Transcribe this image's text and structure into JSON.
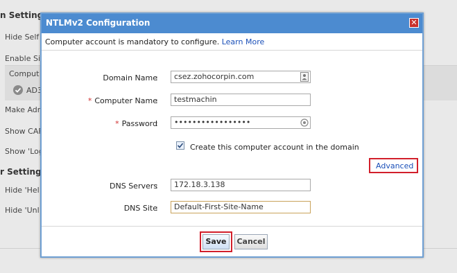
{
  "background": {
    "section1_title": "n Settings",
    "rows1": [
      "Hide Self",
      "Enable Si"
    ],
    "panel_item1": "Comput",
    "panel_item2": "AD3",
    "rows2": [
      "Make Adr",
      "Show CAF",
      "Show 'Log"
    ],
    "section2_title": "r Settings",
    "rows3": [
      "Hide 'Hel",
      "Hide 'Unl"
    ]
  },
  "dialog": {
    "title": "NTLMv2 Configuration",
    "close_symbol": "✕",
    "info_text": "Computer account is mandatory to configure.",
    "learn_more": "Learn More",
    "fields": {
      "domain_name": {
        "label": "Domain Name",
        "value": "csez.zohocorpin.com"
      },
      "computer_name": {
        "label": "Computer Name",
        "required_mark": "*",
        "value": "testmachin"
      },
      "password": {
        "label": "Password",
        "required_mark": "*",
        "value": "•••••••••••••••••"
      },
      "dns_servers": {
        "label": "DNS Servers",
        "value": "172.18.3.138"
      },
      "dns_site": {
        "label": "DNS Site",
        "value": "Default-First-Site-Name"
      }
    },
    "colon": ":",
    "create_account_label": "Create this computer account in the domain",
    "create_account_checked": true,
    "advanced": "Advanced",
    "save": "Save",
    "cancel": "Cancel"
  },
  "colors": {
    "header": "#4c8bd0",
    "highlight": "#d21f2b",
    "link": "#1a4fb8"
  }
}
